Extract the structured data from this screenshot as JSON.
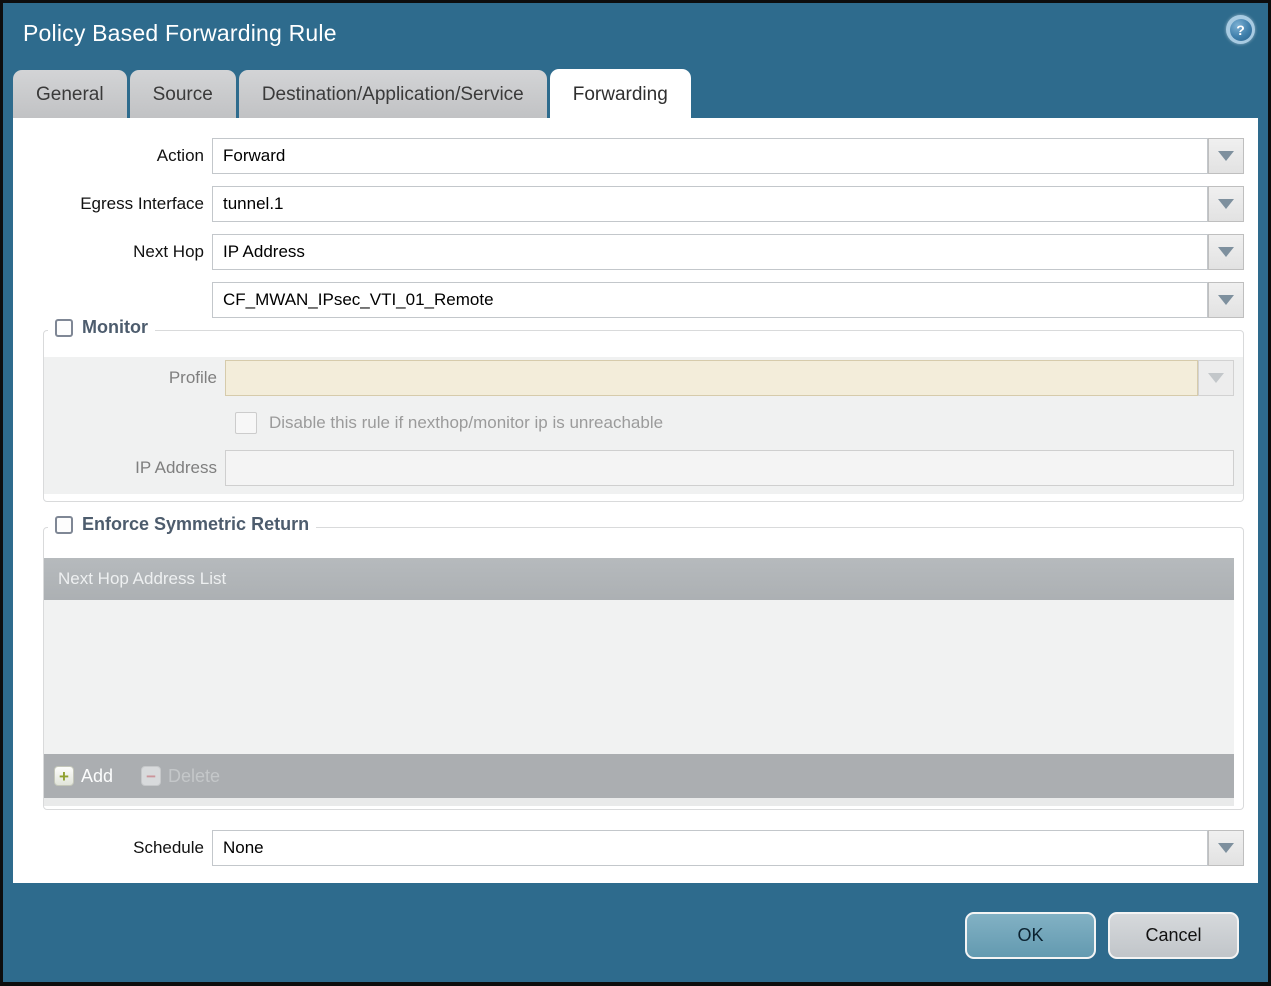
{
  "window": {
    "title": "Policy Based Forwarding Rule"
  },
  "icons": {
    "help": "?",
    "dropdown": "chevron-down-triangle",
    "add": "+",
    "delete": "−"
  },
  "colors": {
    "titlebar_teal": "#2e6b8d",
    "tab_inactive": "#c6c7c9",
    "section_label": "#4d5c6d",
    "profile_disabled_bg": "#f3edda",
    "table_header": "#b1b5b8",
    "table_footer": "#abaeb1",
    "ok_button": "#6fa3ba",
    "cancel_button": "#c9cdd1"
  },
  "tabs": [
    {
      "label": "General",
      "active": false
    },
    {
      "label": "Source",
      "active": false
    },
    {
      "label": "Destination/Application/Service",
      "active": false
    },
    {
      "label": "Forwarding",
      "active": true
    }
  ],
  "form": {
    "action": {
      "label": "Action",
      "value": "Forward"
    },
    "egress_interface": {
      "label": "Egress Interface",
      "value": "tunnel.1"
    },
    "next_hop": {
      "label": "Next Hop",
      "value": "IP Address"
    },
    "next_hop_address": {
      "value": "CF_MWAN_IPsec_VTI_01_Remote"
    },
    "schedule": {
      "label": "Schedule",
      "value": "None"
    }
  },
  "monitor": {
    "label": "Monitor",
    "checked": false,
    "profile": {
      "label": "Profile",
      "value": ""
    },
    "disable_rule": {
      "label": "Disable this rule if nexthop/monitor ip is unreachable",
      "checked": false
    },
    "ip_address": {
      "label": "IP Address",
      "value": ""
    }
  },
  "symmetric_return": {
    "label": "Enforce Symmetric Return",
    "checked": false,
    "table": {
      "header": "Next Hop Address List",
      "rows": []
    },
    "add_label": "Add",
    "delete_label": "Delete"
  },
  "footer": {
    "ok": "OK",
    "cancel": "Cancel"
  }
}
